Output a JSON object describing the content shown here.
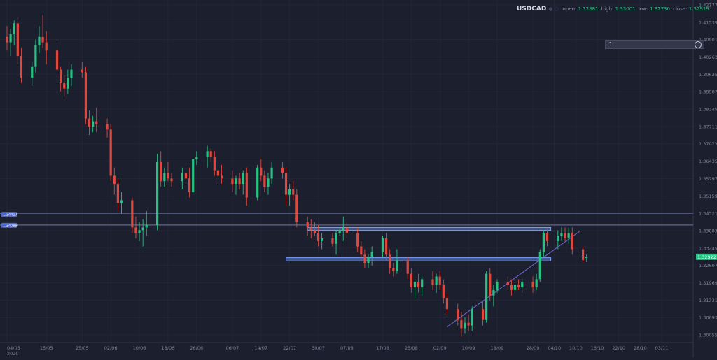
{
  "header": {
    "symbol": "USDCAD",
    "open_label": "open:",
    "open": "1.32881",
    "high_label": "high:",
    "high": "1.33001",
    "low_label": "low:",
    "low": "1.32730",
    "close_label": "close:",
    "close": "1.32919"
  },
  "timeframe": {
    "value": "1"
  },
  "colors": {
    "background": "#1c1f2e",
    "bull": "#26c281",
    "bear": "#e0483e",
    "zone_fill": "#5a7fd6",
    "zone_edge": "#7fa2ff",
    "level_line": "#7d86c6",
    "trendline": "#6f66c9",
    "price_tag": "#26c281",
    "axis_text": "#7c8296",
    "grid": "#262a3a"
  },
  "chart_data": {
    "type": "candlestick",
    "symbol": "USDCAD",
    "y_axis_ticks": [
      "1.42177",
      "1.41539",
      "1.40901",
      "1.40263",
      "1.39625",
      "1.38987",
      "1.38349",
      "1.37711",
      "1.37073",
      "1.36435",
      "1.35797",
      "1.35159",
      "1.34521",
      "1.33883",
      "1.33245",
      "1.32607",
      "1.31969",
      "1.31331",
      "1.30693",
      "1.30055"
    ],
    "x_axis_ticks": [
      "04/05\n2020",
      "15/05",
      "25/05",
      "02/06",
      "10/06",
      "18/06",
      "26/06",
      "06/07",
      "14/07",
      "22/07",
      "30/07",
      "07/08",
      "17/08",
      "25/08",
      "02/09",
      "10/09",
      "18/09",
      "28/09",
      "04/10",
      "10/10",
      "16/10",
      "22/10",
      "28/10",
      "03/11"
    ],
    "last_price": "1.32922",
    "left_price_labels": [
      "1.34417",
      "1.34089"
    ],
    "horizontal_levels": [
      1.34521,
      1.34089,
      1.32922
    ],
    "zones": [
      {
        "x0": "27/07",
        "x1": "03/10",
        "y_top": 1.34,
        "y_bottom": 1.3389
      },
      {
        "x0": "21/07",
        "x1": "03/10",
        "y_top": 1.3289,
        "y_bottom": 1.3277
      }
    ],
    "trendline": {
      "from": {
        "date": "04/09",
        "price": 1.3035
      },
      "to": {
        "date": "11/10",
        "price": 1.3385
      }
    },
    "candles": [
      {
        "date": "04/05",
        "o": 1.41,
        "h": 1.414,
        "l": 1.405,
        "c": 1.408
      },
      {
        "date": "05/05",
        "o": 1.408,
        "h": 1.413,
        "l": 1.403,
        "c": 1.411
      },
      {
        "date": "06/05",
        "o": 1.411,
        "h": 1.416,
        "l": 1.407,
        "c": 1.415
      },
      {
        "date": "07/05",
        "o": 1.415,
        "h": 1.417,
        "l": 1.4,
        "c": 1.403
      },
      {
        "date": "08/05",
        "o": 1.403,
        "h": 1.406,
        "l": 1.393,
        "c": 1.395
      },
      {
        "date": "11/05",
        "o": 1.395,
        "h": 1.401,
        "l": 1.392,
        "c": 1.399
      },
      {
        "date": "12/05",
        "o": 1.399,
        "h": 1.409,
        "l": 1.397,
        "c": 1.407
      },
      {
        "date": "13/05",
        "o": 1.407,
        "h": 1.414,
        "l": 1.404,
        "c": 1.41
      },
      {
        "date": "14/05",
        "o": 1.41,
        "h": 1.418,
        "l": 1.406,
        "c": 1.408
      },
      {
        "date": "15/05",
        "o": 1.408,
        "h": 1.412,
        "l": 1.4,
        "c": 1.405
      },
      {
        "date": "18/05",
        "o": 1.405,
        "h": 1.408,
        "l": 1.395,
        "c": 1.398
      },
      {
        "date": "19/05",
        "o": 1.398,
        "h": 1.399,
        "l": 1.39,
        "c": 1.393
      },
      {
        "date": "20/05",
        "o": 1.393,
        "h": 1.396,
        "l": 1.388,
        "c": 1.391
      },
      {
        "date": "21/05",
        "o": 1.391,
        "h": 1.398,
        "l": 1.389,
        "c": 1.395
      },
      {
        "date": "22/05",
        "o": 1.395,
        "h": 1.4,
        "l": 1.392,
        "c": 1.398
      },
      {
        "date": "25/05",
        "o": 1.398,
        "h": 1.401,
        "l": 1.395,
        "c": 1.397
      },
      {
        "date": "26/05",
        "o": 1.397,
        "h": 1.399,
        "l": 1.378,
        "c": 1.38
      },
      {
        "date": "27/05",
        "o": 1.38,
        "h": 1.383,
        "l": 1.374,
        "c": 1.377
      },
      {
        "date": "28/05",
        "o": 1.377,
        "h": 1.381,
        "l": 1.375,
        "c": 1.379
      },
      {
        "date": "29/05",
        "o": 1.379,
        "h": 1.384,
        "l": 1.375,
        "c": 1.378
      },
      {
        "date": "01/06",
        "o": 1.378,
        "h": 1.38,
        "l": 1.373,
        "c": 1.376
      },
      {
        "date": "02/06",
        "o": 1.376,
        "h": 1.378,
        "l": 1.357,
        "c": 1.359
      },
      {
        "date": "03/06",
        "o": 1.359,
        "h": 1.362,
        "l": 1.352,
        "c": 1.356
      },
      {
        "date": "04/06",
        "o": 1.356,
        "h": 1.358,
        "l": 1.346,
        "c": 1.349
      },
      {
        "date": "05/06",
        "o": 1.349,
        "h": 1.353,
        "l": 1.345,
        "c": 1.35
      },
      {
        "date": "08/06",
        "o": 1.35,
        "h": 1.351,
        "l": 1.338,
        "c": 1.34
      },
      {
        "date": "09/06",
        "o": 1.34,
        "h": 1.344,
        "l": 1.336,
        "c": 1.338
      },
      {
        "date": "10/06",
        "o": 1.338,
        "h": 1.342,
        "l": 1.335,
        "c": 1.339
      },
      {
        "date": "11/06",
        "o": 1.339,
        "h": 1.343,
        "l": 1.333,
        "c": 1.34
      },
      {
        "date": "12/06",
        "o": 1.34,
        "h": 1.346,
        "l": 1.337,
        "c": 1.341
      },
      {
        "date": "15/06",
        "o": 1.341,
        "h": 1.367,
        "l": 1.339,
        "c": 1.364
      },
      {
        "date": "16/06",
        "o": 1.364,
        "h": 1.368,
        "l": 1.355,
        "c": 1.357
      },
      {
        "date": "17/06",
        "o": 1.357,
        "h": 1.362,
        "l": 1.355,
        "c": 1.36
      },
      {
        "date": "18/06",
        "o": 1.36,
        "h": 1.364,
        "l": 1.357,
        "c": 1.358
      },
      {
        "date": "19/06",
        "o": 1.358,
        "h": 1.36,
        "l": 1.355,
        "c": 1.357
      },
      {
        "date": "22/06",
        "o": 1.357,
        "h": 1.362,
        "l": 1.354,
        "c": 1.36
      },
      {
        "date": "23/06",
        "o": 1.36,
        "h": 1.363,
        "l": 1.356,
        "c": 1.358
      },
      {
        "date": "24/06",
        "o": 1.358,
        "h": 1.362,
        "l": 1.351,
        "c": 1.353
      },
      {
        "date": "25/06",
        "o": 1.353,
        "h": 1.365,
        "l": 1.352,
        "c": 1.365
      },
      {
        "date": "26/06",
        "o": 1.365,
        "h": 1.368,
        "l": 1.363,
        "c": 1.366
      },
      {
        "date": "29/06",
        "o": 1.366,
        "h": 1.37,
        "l": 1.362,
        "c": 1.368
      },
      {
        "date": "30/06",
        "o": 1.368,
        "h": 1.369,
        "l": 1.364,
        "c": 1.366
      },
      {
        "date": "01/07",
        "o": 1.366,
        "h": 1.368,
        "l": 1.359,
        "c": 1.361
      },
      {
        "date": "02/07",
        "o": 1.361,
        "h": 1.364,
        "l": 1.356,
        "c": 1.359
      },
      {
        "date": "03/07",
        "o": 1.359,
        "h": 1.363,
        "l": 1.356,
        "c": 1.358
      },
      {
        "date": "06/07",
        "o": 1.358,
        "h": 1.361,
        "l": 1.353,
        "c": 1.356
      },
      {
        "date": "07/07",
        "o": 1.356,
        "h": 1.359,
        "l": 1.352,
        "c": 1.358
      },
      {
        "date": "08/07",
        "o": 1.358,
        "h": 1.36,
        "l": 1.354,
        "c": 1.356
      },
      {
        "date": "09/07",
        "o": 1.356,
        "h": 1.361,
        "l": 1.352,
        "c": 1.36
      },
      {
        "date": "10/07",
        "o": 1.36,
        "h": 1.362,
        "l": 1.348,
        "c": 1.351
      },
      {
        "date": "13/07",
        "o": 1.351,
        "h": 1.363,
        "l": 1.35,
        "c": 1.362
      },
      {
        "date": "14/07",
        "o": 1.362,
        "h": 1.365,
        "l": 1.357,
        "c": 1.359
      },
      {
        "date": "15/07",
        "o": 1.359,
        "h": 1.361,
        "l": 1.353,
        "c": 1.355
      },
      {
        "date": "16/07",
        "o": 1.355,
        "h": 1.36,
        "l": 1.352,
        "c": 1.358
      },
      {
        "date": "17/07",
        "o": 1.358,
        "h": 1.364,
        "l": 1.356,
        "c": 1.362
      },
      {
        "date": "20/07",
        "o": 1.362,
        "h": 1.364,
        "l": 1.358,
        "c": 1.36
      },
      {
        "date": "21/07",
        "o": 1.36,
        "h": 1.362,
        "l": 1.348,
        "c": 1.352
      },
      {
        "date": "22/07",
        "o": 1.352,
        "h": 1.356,
        "l": 1.348,
        "c": 1.354
      },
      {
        "date": "23/07",
        "o": 1.354,
        "h": 1.357,
        "l": 1.35,
        "c": 1.352
      },
      {
        "date": "24/07",
        "o": 1.352,
        "h": 1.354,
        "l": 1.34,
        "c": 1.342
      },
      {
        "date": "27/07",
        "o": 1.342,
        "h": 1.344,
        "l": 1.337,
        "c": 1.34
      },
      {
        "date": "28/07",
        "o": 1.34,
        "h": 1.343,
        "l": 1.336,
        "c": 1.339
      },
      {
        "date": "29/07",
        "o": 1.339,
        "h": 1.342,
        "l": 1.337,
        "c": 1.338
      },
      {
        "date": "30/07",
        "o": 1.338,
        "h": 1.341,
        "l": 1.333,
        "c": 1.335
      },
      {
        "date": "31/07",
        "o": 1.335,
        "h": 1.338,
        "l": 1.332,
        "c": 1.336
      },
      {
        "date": "03/08",
        "o": 1.336,
        "h": 1.338,
        "l": 1.333,
        "c": 1.334
      },
      {
        "date": "04/08",
        "o": 1.334,
        "h": 1.339,
        "l": 1.33,
        "c": 1.338
      },
      {
        "date": "05/08",
        "o": 1.338,
        "h": 1.34,
        "l": 1.337,
        "c": 1.339
      },
      {
        "date": "06/08",
        "o": 1.339,
        "h": 1.344,
        "l": 1.335,
        "c": 1.34
      },
      {
        "date": "07/08",
        "o": 1.34,
        "h": 1.342,
        "l": 1.336,
        "c": 1.338
      },
      {
        "date": "10/08",
        "o": 1.338,
        "h": 1.34,
        "l": 1.331,
        "c": 1.333
      },
      {
        "date": "11/08",
        "o": 1.333,
        "h": 1.335,
        "l": 1.328,
        "c": 1.33
      },
      {
        "date": "12/08",
        "o": 1.33,
        "h": 1.332,
        "l": 1.325,
        "c": 1.327
      },
      {
        "date": "13/08",
        "o": 1.327,
        "h": 1.33,
        "l": 1.325,
        "c": 1.329
      },
      {
        "date": "14/08",
        "o": 1.329,
        "h": 1.333,
        "l": 1.326,
        "c": 1.331
      },
      {
        "date": "17/08",
        "o": 1.331,
        "h": 1.337,
        "l": 1.329,
        "c": 1.336
      },
      {
        "date": "18/08",
        "o": 1.336,
        "h": 1.338,
        "l": 1.328,
        "c": 1.33
      },
      {
        "date": "19/08",
        "o": 1.33,
        "h": 1.332,
        "l": 1.323,
        "c": 1.325
      },
      {
        "date": "20/08",
        "o": 1.325,
        "h": 1.327,
        "l": 1.322,
        "c": 1.324
      },
      {
        "date": "21/08",
        "o": 1.324,
        "h": 1.332,
        "l": 1.323,
        "c": 1.328
      },
      {
        "date": "24/08",
        "o": 1.328,
        "h": 1.329,
        "l": 1.321,
        "c": 1.323
      },
      {
        "date": "25/08",
        "o": 1.323,
        "h": 1.325,
        "l": 1.316,
        "c": 1.318
      },
      {
        "date": "26/08",
        "o": 1.318,
        "h": 1.321,
        "l": 1.314,
        "c": 1.32
      },
      {
        "date": "27/08",
        "o": 1.32,
        "h": 1.323,
        "l": 1.316,
        "c": 1.318
      },
      {
        "date": "28/08",
        "o": 1.318,
        "h": 1.322,
        "l": 1.315,
        "c": 1.321
      },
      {
        "date": "31/08",
        "o": 1.321,
        "h": 1.324,
        "l": 1.317,
        "c": 1.319
      },
      {
        "date": "01/09",
        "o": 1.319,
        "h": 1.323,
        "l": 1.316,
        "c": 1.322
      },
      {
        "date": "02/09",
        "o": 1.322,
        "h": 1.324,
        "l": 1.317,
        "c": 1.319
      },
      {
        "date": "03/09",
        "o": 1.319,
        "h": 1.321,
        "l": 1.312,
        "c": 1.314
      },
      {
        "date": "04/09",
        "o": 1.314,
        "h": 1.316,
        "l": 1.308,
        "c": 1.31
      },
      {
        "date": "07/09",
        "o": 1.31,
        "h": 1.312,
        "l": 1.304,
        "c": 1.306
      },
      {
        "date": "08/09",
        "o": 1.306,
        "h": 1.309,
        "l": 1.3,
        "c": 1.303
      },
      {
        "date": "09/09",
        "o": 1.303,
        "h": 1.307,
        "l": 1.301,
        "c": 1.305
      },
      {
        "date": "10/09",
        "o": 1.305,
        "h": 1.308,
        "l": 1.302,
        "c": 1.304
      },
      {
        "date": "11/09",
        "o": 1.304,
        "h": 1.311,
        "l": 1.302,
        "c": 1.31
      },
      {
        "date": "14/09",
        "o": 1.31,
        "h": 1.313,
        "l": 1.304,
        "c": 1.306
      },
      {
        "date": "15/09",
        "o": 1.306,
        "h": 1.324,
        "l": 1.305,
        "c": 1.323
      },
      {
        "date": "16/09",
        "o": 1.323,
        "h": 1.325,
        "l": 1.313,
        "c": 1.315
      },
      {
        "date": "17/09",
        "o": 1.315,
        "h": 1.319,
        "l": 1.311,
        "c": 1.317
      },
      {
        "date": "18/09",
        "o": 1.317,
        "h": 1.321,
        "l": 1.316,
        "c": 1.32
      },
      {
        "date": "21/09",
        "o": 1.32,
        "h": 1.322,
        "l": 1.317,
        "c": 1.319
      },
      {
        "date": "22/09",
        "o": 1.319,
        "h": 1.321,
        "l": 1.315,
        "c": 1.317
      },
      {
        "date": "23/09",
        "o": 1.317,
        "h": 1.32,
        "l": 1.315,
        "c": 1.319
      },
      {
        "date": "24/09",
        "o": 1.319,
        "h": 1.321,
        "l": 1.317,
        "c": 1.318
      },
      {
        "date": "25/09",
        "o": 1.318,
        "h": 1.321,
        "l": 1.316,
        "c": 1.32
      },
      {
        "date": "28/09",
        "o": 1.32,
        "h": 1.322,
        "l": 1.316,
        "c": 1.318
      },
      {
        "date": "29/09",
        "o": 1.318,
        "h": 1.323,
        "l": 1.317,
        "c": 1.321
      },
      {
        "date": "30/09",
        "o": 1.321,
        "h": 1.332,
        "l": 1.32,
        "c": 1.331
      },
      {
        "date": "01/10",
        "o": 1.331,
        "h": 1.339,
        "l": 1.329,
        "c": 1.338
      },
      {
        "date": "02/10",
        "o": 1.338,
        "h": 1.34,
        "l": 1.333,
        "c": 1.335
      },
      {
        "date": "05/10",
        "o": 1.335,
        "h": 1.339,
        "l": 1.332,
        "c": 1.337
      },
      {
        "date": "06/10",
        "o": 1.337,
        "h": 1.34,
        "l": 1.335,
        "c": 1.338
      },
      {
        "date": "07/10",
        "o": 1.338,
        "h": 1.34,
        "l": 1.335,
        "c": 1.336
      },
      {
        "date": "08/10",
        "o": 1.336,
        "h": 1.34,
        "l": 1.334,
        "c": 1.338
      },
      {
        "date": "09/10",
        "o": 1.338,
        "h": 1.34,
        "l": 1.33,
        "c": 1.332
      },
      {
        "date": "12/10",
        "o": 1.332,
        "h": 1.333,
        "l": 1.327,
        "c": 1.328
      },
      {
        "date": "13/10",
        "o": 1.3288,
        "h": 1.33,
        "l": 1.3273,
        "c": 1.3292
      }
    ]
  }
}
